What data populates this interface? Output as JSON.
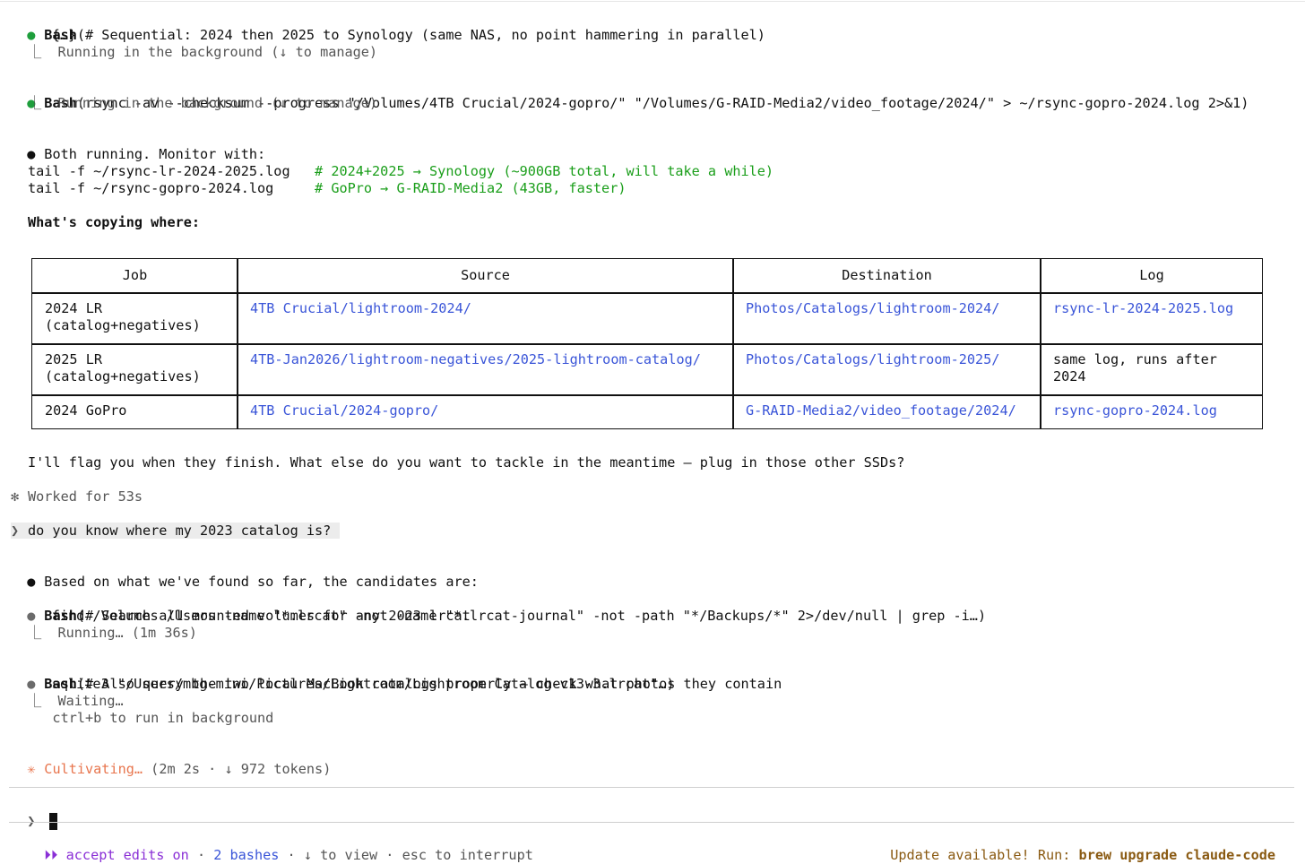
{
  "block1": {
    "tool": "Bash",
    "command": "(# Sequential: 2024 then 2025 to Synology (same NAS, no point hammering in parallel)",
    "continuation": "     {…}",
    "status": "⎿  Running in the background (↓ to manage)"
  },
  "block2": {
    "tool": "Bash",
    "command": "(rsync -av --checksum --progress \"/Volumes/4TB Crucial/2024-gopro/\" \"/Volumes/G-RAID-Media2/video_footage/2024/\" > ~/rsync-gopro-2024.log 2>&1)",
    "status": "⎿  Running in the background (↓ to manage)"
  },
  "msg1": "Both running. Monitor with:",
  "code": [
    {
      "cmd": "tail -f ~/rsync-lr-2024-2025.log   ",
      "comment": "# 2024+2025 → Synology (~900GB total, will take a while)"
    },
    {
      "cmd": "tail -f ~/rsync-gopro-2024.log     ",
      "comment": "# GoPro → G-RAID-Media2 (43GB, faster)"
    }
  ],
  "heading": "What's copying where:",
  "table": {
    "headers": [
      "Job",
      "Source",
      "Destination",
      "Log"
    ],
    "rows": [
      [
        "2024 LR\n(catalog+negatives)",
        "4TB Crucial/lightroom-2024/",
        "Photos/Catalogs/lightroom-2024/",
        "rsync-lr-2024-2025.log"
      ],
      [
        "2025 LR\n(catalog+negatives)",
        "4TB-Jan2026/lightroom-negatives/2025-lightroom-catalog/",
        "Photos/Catalogs/lightroom-2025/",
        "same log, runs after\n2024"
      ],
      [
        "2024 GoPro",
        "4TB Crucial/2024-gopro/",
        "G-RAID-Media2/video_footage/2024/",
        "rsync-gopro-2024.log"
      ]
    ]
  },
  "msg2": "I'll flag you when they finish. What else do you want to tackle in the meantime — plug in those other SSDs?",
  "worked": "Worked for 53s",
  "user_prompt": "do you know where my 2023 catalog is?",
  "msg3": "Based on what we've found so far, the candidates are:",
  "block3": {
    "tool": "Bash",
    "command": "(# Search all mounted volumes for any 2023 lrcat",
    "continuation": "     find /Volumes /Users -name \"*.lrcat\" -not -name \"*.lrcat-journal\" -not -path \"*/Backups/*\" 2>/dev/null | grep -i…)",
    "status": "⎿  Running… (1m 36s)"
  },
  "block4": {
    "tool": "Bash",
    "command": "(# Also query the two local MacBook catalogs properly — check what photos they contain",
    "continuation": "     sqlite3 \"/Users/mbg-mini/Pictures/Lightroom/Lightroom Catalog-v13-3.lrcat\"…)",
    "status": "⎿  Waiting…",
    "hint": "   ctrl+b to run in background"
  },
  "spinner": {
    "label": "Cultivating…",
    "detail": " (2m 2s · ↓ 972 tokens)"
  },
  "input_caret": "❯",
  "status_bar": {
    "mode_icon": "⏵⏵",
    "mode": "accept edits on",
    "sep": " · ",
    "bashes": "2 bashes",
    "view": "↓ to view",
    "interrupt": "esc to interrupt",
    "update_prefix": "Update available! Run: ",
    "update_cmd": "brew upgrade claude-code"
  },
  "colors": {
    "green_dot": "#1e9e3c",
    "comment_green": "#1a9e1a",
    "link_blue": "#3a55d8",
    "spinner_orange": "#e8754d",
    "mode_purple": "#8a2fd6",
    "update_brown": "#8a5a12"
  }
}
